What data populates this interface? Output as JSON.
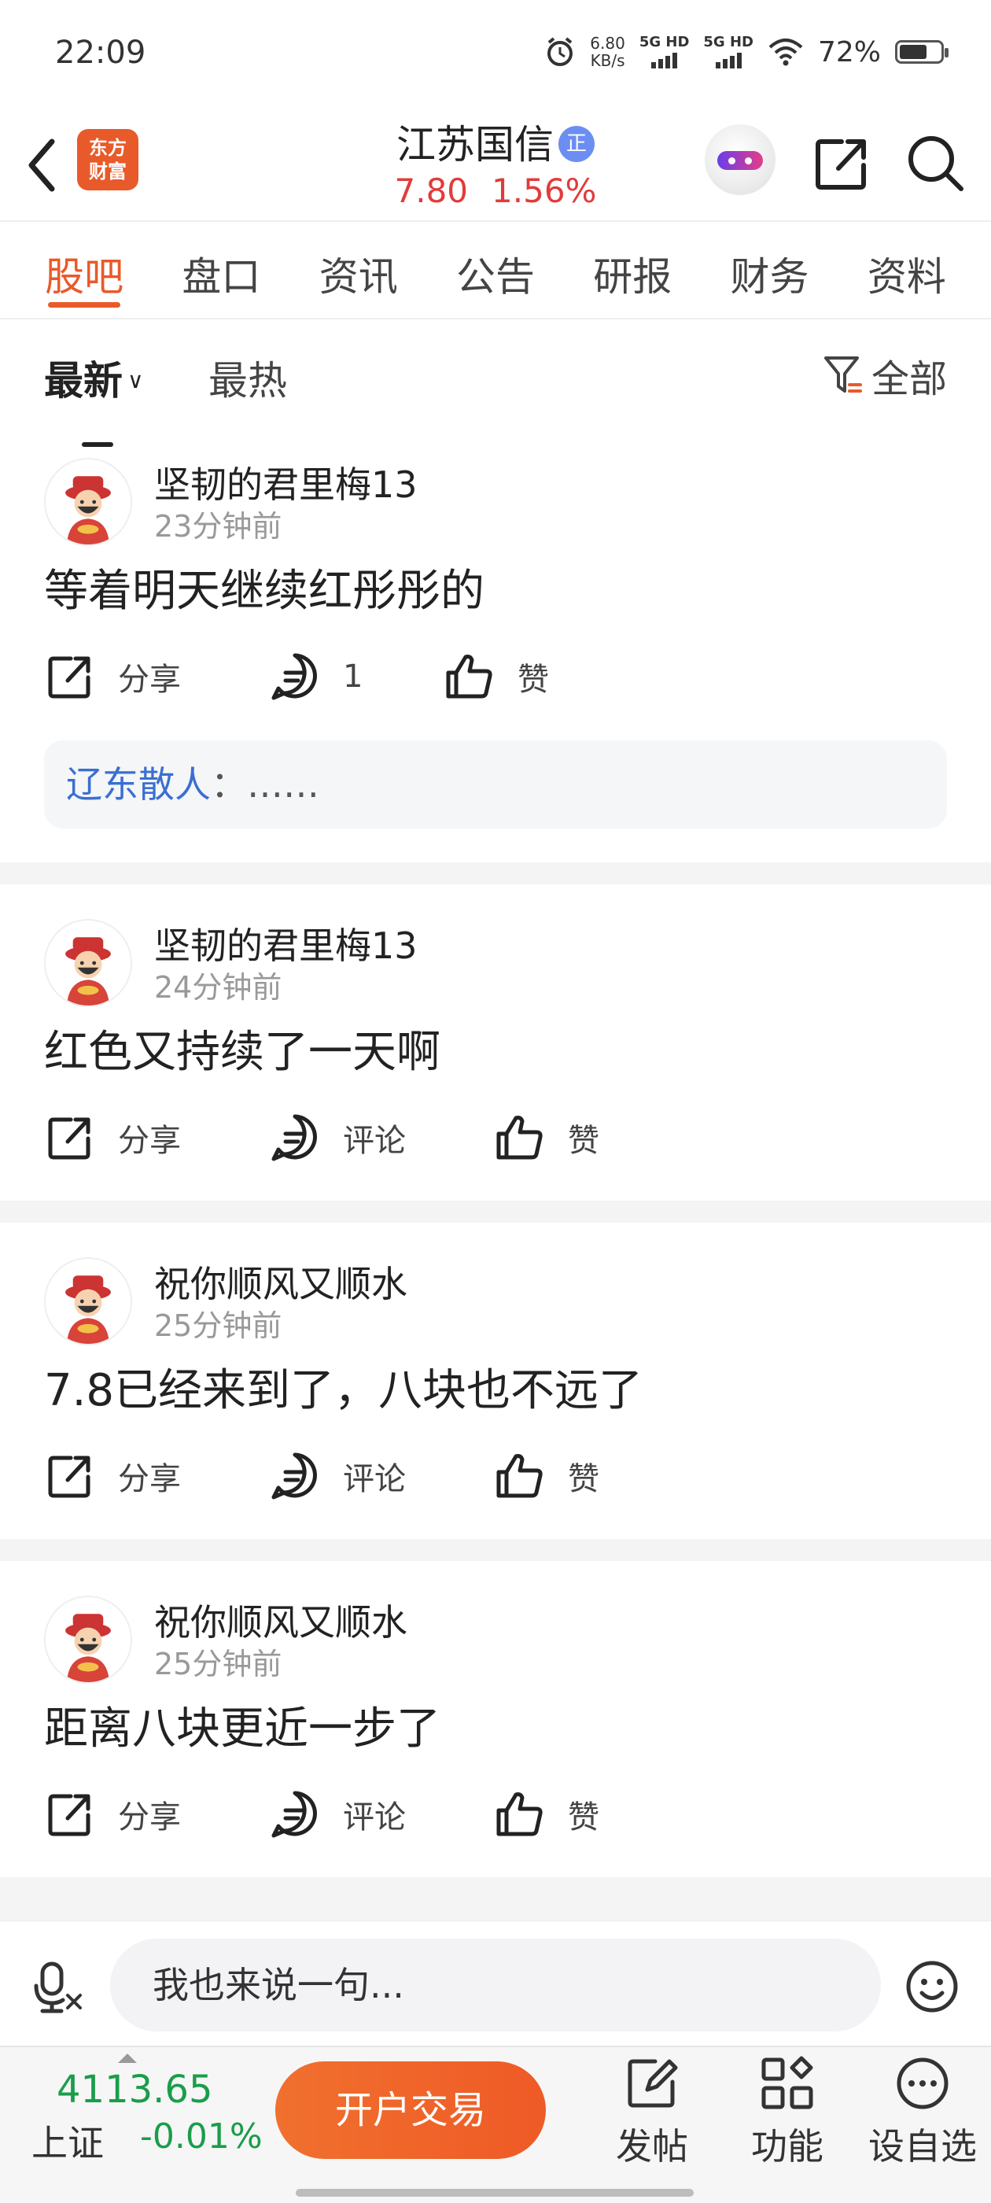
{
  "status_bar": {
    "time": "22:09",
    "net_speed_value": "6.80",
    "net_speed_unit": "KB/s",
    "signal_1": "5G HD",
    "signal_2": "5G HD",
    "battery_percent": "72%",
    "battery_level": 0.72
  },
  "header": {
    "logo_line1": "东方",
    "logo_line2": "财富",
    "stock_name": "江苏国信",
    "stock_tag": "正",
    "price": "7.80",
    "change_pct": "1.56%"
  },
  "tabs": [
    {
      "label": "股吧",
      "active": true
    },
    {
      "label": "盘口"
    },
    {
      "label": "资讯"
    },
    {
      "label": "公告"
    },
    {
      "label": "研报"
    },
    {
      "label": "财务"
    },
    {
      "label": "资料"
    }
  ],
  "filter": {
    "sort_latest": "最新",
    "sort_hot": "最热",
    "filter_all": "全部"
  },
  "posts": [
    {
      "user": "坚韧的君里梅13",
      "time": "23分钟前",
      "content": "等着明天继续红彤彤的",
      "share": "分享",
      "comment": "1",
      "like": "赞",
      "reply_user": "辽东散人",
      "reply_text": "：……"
    },
    {
      "user": "坚韧的君里梅13",
      "time": "24分钟前",
      "content": "红色又持续了一天啊",
      "share": "分享",
      "comment": "评论",
      "like": "赞"
    },
    {
      "user": "祝你顺风又顺水",
      "time": "25分钟前",
      "content": "7.8已经来到了，八块也不远了",
      "share": "分享",
      "comment": "评论",
      "like": "赞"
    },
    {
      "user": "祝你顺风又顺水",
      "time": "25分钟前",
      "content": "距离八块更近一步了",
      "share": "分享",
      "comment": "评论",
      "like": "赞"
    }
  ],
  "input_bar": {
    "placeholder": "我也来说一句..."
  },
  "toolbar": {
    "index_value": "4113.65",
    "index_name": "上证",
    "index_change": "-0.01%",
    "trade_button": "开户交易",
    "post_label": "发帖",
    "function_label": "功能",
    "watchlist_label": "设自选"
  },
  "colors": {
    "accent": "#e85a2a",
    "price_up": "#e23b3b",
    "index_green": "#1a9d4a",
    "reply_user_blue": "#3a6fd2"
  }
}
